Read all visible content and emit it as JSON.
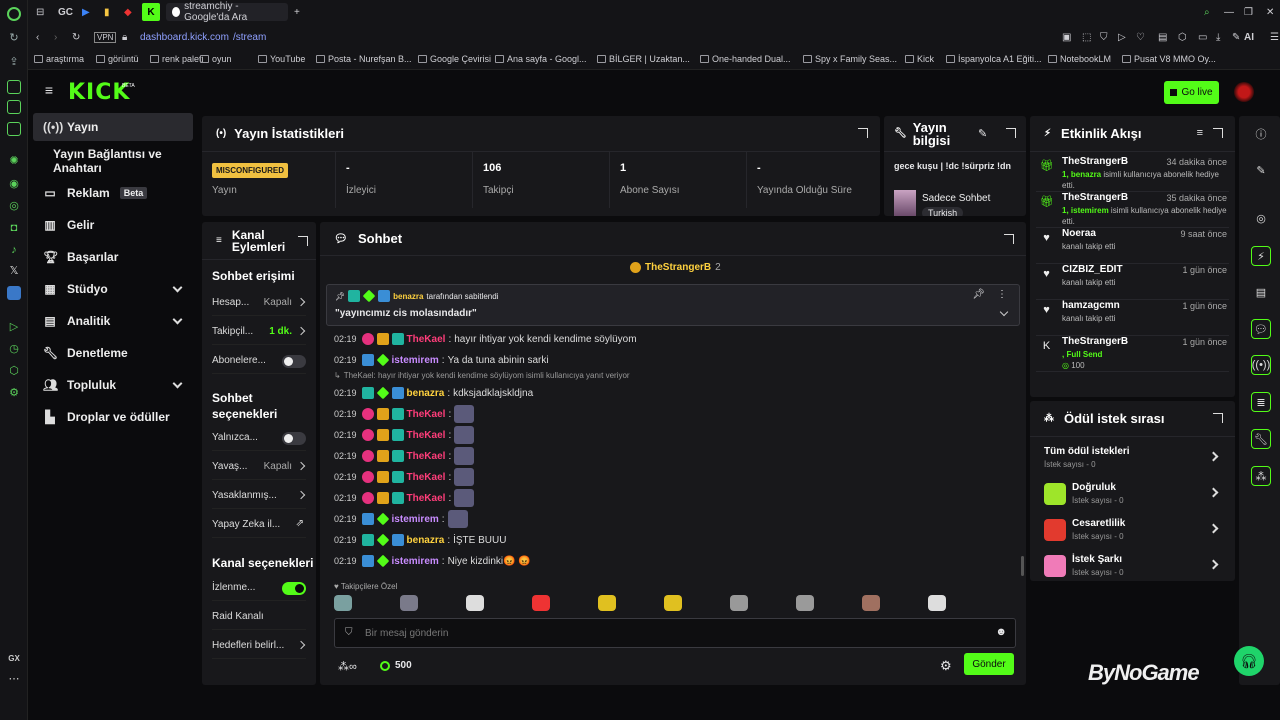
{
  "browser": {
    "tab_title": "streamchiy - Google'da Ara",
    "tab_prefix": "GC",
    "url_vpn": "VPN",
    "url_host": "dashboard.kick.com",
    "url_path": "/stream",
    "ai_label": "AI",
    "gx_label": "GX",
    "bookmarks": [
      "araştırma",
      "görüntü",
      "renk paleti",
      "oyun",
      "YouTube",
      "Posta - Nurefşan B...",
      "Google Çevirisi",
      "Ana sayfa - Googl...",
      "BİLGER | Uzaktan...",
      "One-handed Dual...",
      "Spy x Family Seas...",
      "Kick",
      "İspanyolca A1 Eğiti...",
      "NotebookLM",
      "Pusat V8 MMO Oy..."
    ]
  },
  "header": {
    "logo": "KICK",
    "beta": "BETA",
    "go_live": "Go live"
  },
  "sidebar": {
    "items": [
      {
        "label": "Yayın"
      },
      {
        "label": "Yayın Bağlantısı ve Anahtarı"
      },
      {
        "label": "Reklam",
        "badge": "Beta"
      },
      {
        "label": "Gelir"
      },
      {
        "label": "Başarılar"
      },
      {
        "label": "Stüdyo"
      },
      {
        "label": "Analitik"
      },
      {
        "label": "Denetleme"
      },
      {
        "label": "Topluluk"
      },
      {
        "label": "Droplar ve ödüller"
      }
    ]
  },
  "stats": {
    "title": "Yayın İstatistikleri",
    "badge": "MISCONFIGURED",
    "items": [
      {
        "value": "",
        "label": "Yayın"
      },
      {
        "value": "-",
        "label": "İzleyici"
      },
      {
        "value": "106",
        "label": "Takipçi"
      },
      {
        "value": "1",
        "label": "Abone Sayısı"
      },
      {
        "value": "-",
        "label": "Yayında Olduğu Süre"
      }
    ]
  },
  "stream_info": {
    "title": "Yayın bilgisi",
    "stream_title": "gece kuşu | !dc !sürpriz !dn",
    "category": "Sadece Sohbet",
    "language": "Turkish"
  },
  "channel_actions": {
    "title": "Kanal Eylemleri",
    "chat_access": "Sohbet erişimi",
    "rows1": [
      {
        "label": "Hesap...",
        "value": "Kapalı",
        "kind": "arrow"
      },
      {
        "label": "Takipçil...",
        "value": "1 dk.",
        "kind": "arrow",
        "green": true
      },
      {
        "label": "Abonelere...",
        "value": "",
        "kind": "toggle"
      }
    ],
    "chat_options": "Sohbet seçenekleri",
    "rows2": [
      {
        "label": "Yalnızca...",
        "value": "",
        "kind": "toggle"
      },
      {
        "label": "Yavaş...",
        "value": "Kapalı",
        "kind": "arrow"
      },
      {
        "label": "Yasaklanmış...",
        "value": "",
        "kind": "arrow"
      },
      {
        "label": "Yapay Zeka il...",
        "value": "",
        "kind": "chart"
      }
    ],
    "channel_options": "Kanal seçenekleri",
    "rows3": [
      {
        "label": "İzlenme...",
        "value": "",
        "kind": "toggle-on"
      },
      {
        "label": "Raid Kanalı",
        "value": "",
        "kind": "none"
      },
      {
        "label": "Hedefleri belirl...",
        "value": "",
        "kind": "arrow"
      }
    ]
  },
  "chat": {
    "title": "Sohbet",
    "top_user": "TheStrangerB",
    "top_count": "2",
    "pinned_by": "benazra",
    "pinned_label": "tarafından sabitlendi",
    "pinned_text": "\"yayıncımız cis molasındadır\"",
    "messages": [
      {
        "time": "02:19",
        "user": "TheKael",
        "color": "#ff3d7a",
        "badges": [
          "sub",
          "crown",
          "mod"
        ],
        "text": "hayır ihtiyar yok kendi kendime söylüyom"
      },
      {
        "time": "02:19",
        "user": "istemirem",
        "color": "#c88cff",
        "badges": [
          "vip",
          "og"
        ],
        "text": "Ya da tuna abinin sarki"
      },
      {
        "time": "02:19",
        "user": "benazra",
        "color": "#ffd23f",
        "badges": [
          "mod",
          "og",
          "vip"
        ],
        "text": "kdksjadklajskldjna",
        "reply": "TheKael: hayır ihtiyar yok kendi kendime söylüyom isimli kullanıcıya yanıt veriyor"
      },
      {
        "time": "02:19",
        "user": "TheKael",
        "color": "#ff3d7a",
        "badges": [
          "sub",
          "crown",
          "mod"
        ],
        "text": "",
        "emote": true
      },
      {
        "time": "02:19",
        "user": "TheKael",
        "color": "#ff3d7a",
        "badges": [
          "sub",
          "crown",
          "mod"
        ],
        "text": "",
        "emote": true
      },
      {
        "time": "02:19",
        "user": "TheKael",
        "color": "#ff3d7a",
        "badges": [
          "sub",
          "crown",
          "mod"
        ],
        "text": "",
        "emote": true
      },
      {
        "time": "02:19",
        "user": "TheKael",
        "color": "#ff3d7a",
        "badges": [
          "sub",
          "crown",
          "mod"
        ],
        "text": "",
        "emote": true
      },
      {
        "time": "02:19",
        "user": "TheKael",
        "color": "#ff3d7a",
        "badges": [
          "sub",
          "crown",
          "mod"
        ],
        "text": "",
        "emote": true
      },
      {
        "time": "02:19",
        "user": "istemirem",
        "color": "#c88cff",
        "badges": [
          "vip",
          "og"
        ],
        "text": "",
        "emote": true
      },
      {
        "time": "02:19",
        "user": "benazra",
        "color": "#ffd23f",
        "badges": [
          "mod",
          "og",
          "vip"
        ],
        "text": "İŞTE BUUU"
      },
      {
        "time": "02:19",
        "user": "istemirem",
        "color": "#c88cff",
        "badges": [
          "vip",
          "og"
        ],
        "text": "Niye kizdinki😡 😡"
      }
    ],
    "followers_only": "Takipçilere Özel",
    "placeholder": "Bir mesaj gönderin",
    "points": "500",
    "send": "Gönder"
  },
  "activity": {
    "title": "Etkinlik Akışı",
    "events": [
      {
        "icon": "gift",
        "name": "TheStrangerB",
        "time": "34 dakika önce",
        "hl": "1, benazra",
        "desc": " isimli kullanıcıya abonelik hediye etti."
      },
      {
        "icon": "gift",
        "name": "TheStrangerB",
        "time": "35 dakika önce",
        "hl": "1, istemirem",
        "desc": " isimli kullanıcıya abonelik hediye etti."
      },
      {
        "icon": "heart",
        "name": "Noeraa",
        "time": "9 saat önce",
        "hl": "",
        "desc": "kanalı takip etti"
      },
      {
        "icon": "heart",
        "name": "CIZBIZ_EDIT",
        "time": "1 gün önce",
        "hl": "",
        "desc": "kanalı takip etti"
      },
      {
        "icon": "heart",
        "name": "hamzagcmn",
        "time": "1 gün önce",
        "hl": "",
        "desc": "kanalı takip etti"
      },
      {
        "icon": "kick",
        "name": "TheStrangerB",
        "time": "1 gün önce",
        "hl": ", Full Send",
        "desc": "",
        "extra": "100"
      }
    ]
  },
  "rewards": {
    "title": "Ödül istek sırası",
    "all": "Tüm ödül istekleri",
    "all_count": "İstek sayısı - 0",
    "items": [
      {
        "name": "Doğruluk",
        "count": "İstek sayısı - 0",
        "color": "#9ee52a"
      },
      {
        "name": "Cesaretlilik",
        "count": "İstek sayısı - 0",
        "color": "#e23a2e"
      },
      {
        "name": "İstek Şarkı",
        "count": "İstek sayısı - 0",
        "color": "#f07bb8"
      }
    ]
  },
  "watermark": "ByNoGame"
}
